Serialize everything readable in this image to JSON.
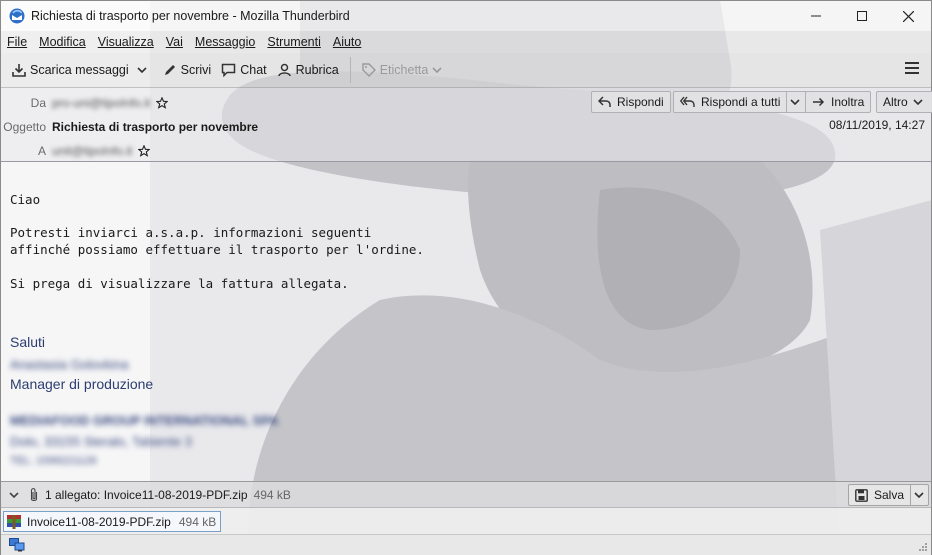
{
  "window": {
    "title": "Richiesta di trasporto per novembre - Mozilla Thunderbird",
    "controls": [
      "minimize",
      "maximize",
      "close"
    ]
  },
  "menubar": {
    "items": [
      "File",
      "Modifica",
      "Visualizza",
      "Vai",
      "Messaggio",
      "Strumenti",
      "Aiuto"
    ]
  },
  "toolbar": {
    "get_messages": "Scarica messaggi",
    "write": "Scrivi",
    "chat": "Chat",
    "address_book": "Rubrica",
    "tag": "Etichetta"
  },
  "header": {
    "from_label": "Da",
    "from_value": "pro-uni@tipoInfo.it",
    "subject_label": "Oggetto",
    "subject_value": "Richiesta di trasporto per novembre",
    "to_label": "A",
    "to_value": "unit@tipoInfo.it",
    "date": "08/11/2019, 14:27",
    "reply": "Rispondi",
    "reply_all": "Rispondi a tutti",
    "forward": "Inoltra",
    "more": "Altro"
  },
  "message": {
    "greeting": "Ciao",
    "line1": "Potresti inviarci a.s.a.p. informazioni seguenti",
    "line2": "affinché possiamo effettuare il trasporto per l'ordine.",
    "line3": "Si prega di visualizzare la fattura allegata.",
    "closing": "Saluti",
    "sender_name": "Anastasia Golovkina",
    "sender_role": "Manager di produzione",
    "company_line1": "MEDIAFOOD GROUP INTERNATIONAL SPA",
    "company_line2": "Dolo, 33155 Steralo, Tabiente 3",
    "company_line3": "TEL: 1599221126"
  },
  "attachment_bar": {
    "summary": "1 allegato: Invoice11-08-2019-PDF.zip",
    "size": "494 kB",
    "save": "Salva"
  },
  "attachment_list": {
    "items": [
      {
        "name": "Invoice11-08-2019-PDF.zip",
        "size": "494 kB"
      }
    ]
  }
}
